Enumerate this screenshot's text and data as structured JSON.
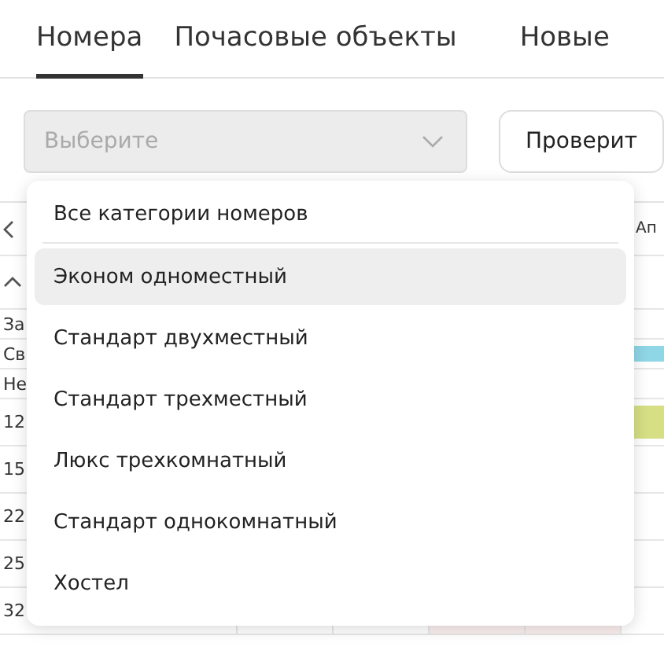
{
  "tabs": [
    {
      "label": "Номера",
      "selected": true
    },
    {
      "label": "Почасовые объекты",
      "selected": false
    },
    {
      "label": "Новые",
      "selected": false
    }
  ],
  "category_select": {
    "placeholder": "Выберите",
    "disabled": true
  },
  "check_button": {
    "label": "Проверит"
  },
  "grid": {
    "header_right": "Ап",
    "rows": [
      {
        "label": "За"
      },
      {
        "label": "Св",
        "color": "#8fd6e6"
      },
      {
        "label": "Не"
      },
      {
        "label": "12",
        "color": "#d6df84"
      },
      {
        "label": "15"
      },
      {
        "label": "22"
      },
      {
        "label": "25"
      },
      {
        "label": "32"
      }
    ]
  },
  "dropdown": {
    "items": [
      {
        "label": "Все категории номеров",
        "selected": false
      },
      {
        "label": "Эконом одноместный",
        "selected": true
      },
      {
        "label": "Стандарт двухместный",
        "selected": false
      },
      {
        "label": "Стандарт трехместный",
        "selected": false
      },
      {
        "label": "Люкс трехкомнатный",
        "selected": false
      },
      {
        "label": "Стандарт однокомнатный",
        "selected": false
      },
      {
        "label": "Хостел",
        "selected": false
      }
    ]
  }
}
